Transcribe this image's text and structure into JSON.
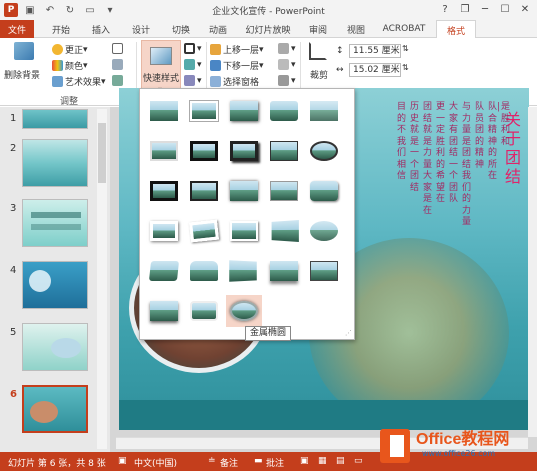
{
  "window": {
    "title": "企业文化宣传 - PowerPoint",
    "app_icon": "P",
    "quick_access": [
      "save-icon",
      "undo-icon",
      "redo-icon",
      "start-slideshow-icon",
      "customize-icon"
    ],
    "controls": [
      "?",
      "❐",
      "─",
      "☐",
      "✕"
    ]
  },
  "tabs": [
    {
      "label": "文件"
    },
    {
      "label": "开始"
    },
    {
      "label": "插入"
    },
    {
      "label": "设计"
    },
    {
      "label": "切换"
    },
    {
      "label": "动画"
    },
    {
      "label": "幻灯片放映"
    },
    {
      "label": "审阅"
    },
    {
      "label": "视图"
    },
    {
      "label": "ACROBAT"
    },
    {
      "label": "格式"
    }
  ],
  "ribbon": {
    "adjust": {
      "remove_bg": "删除背景",
      "corrections": "更正",
      "color": "颜色",
      "artistic": "艺术效果",
      "group_label": "调整"
    },
    "styles": {
      "quick_styles": "快速样式"
    },
    "arrange": {
      "bring_forward": "上移一层",
      "send_backward": "下移一层",
      "selection_pane": "选择窗格"
    },
    "size": {
      "crop": "裁剪",
      "height": "11.55 厘米",
      "width": "15.02 厘米"
    }
  },
  "slides": [
    {
      "number": "1"
    },
    {
      "number": "2"
    },
    {
      "number": "3"
    },
    {
      "number": "4"
    },
    {
      "number": "5"
    },
    {
      "number": "6"
    }
  ],
  "slide_content": {
    "title_chars": "关于团结",
    "columns": [
      "是胜利和",
      "队|合精神的所在",
      "队员团的精神",
      "与力量是团结我们的力量",
      "大家有团结一个团队",
      "更一定胜利的希望在",
      "团结就是力量大家是在",
      "历史就是一个团结",
      "目的不我们相信"
    ]
  },
  "gallery": {
    "tooltip": "金属椭圆",
    "rows": 6,
    "cols": 5,
    "last_row_count": 3,
    "hover_cell": "6-3"
  },
  "status": {
    "slide_info": "幻灯片 第 6 张，共 8 张",
    "language": "中文(中国)",
    "notes": "备注",
    "comments": "批注"
  },
  "watermark": {
    "brand": "Office教程网",
    "url": "www.office26.com"
  }
}
